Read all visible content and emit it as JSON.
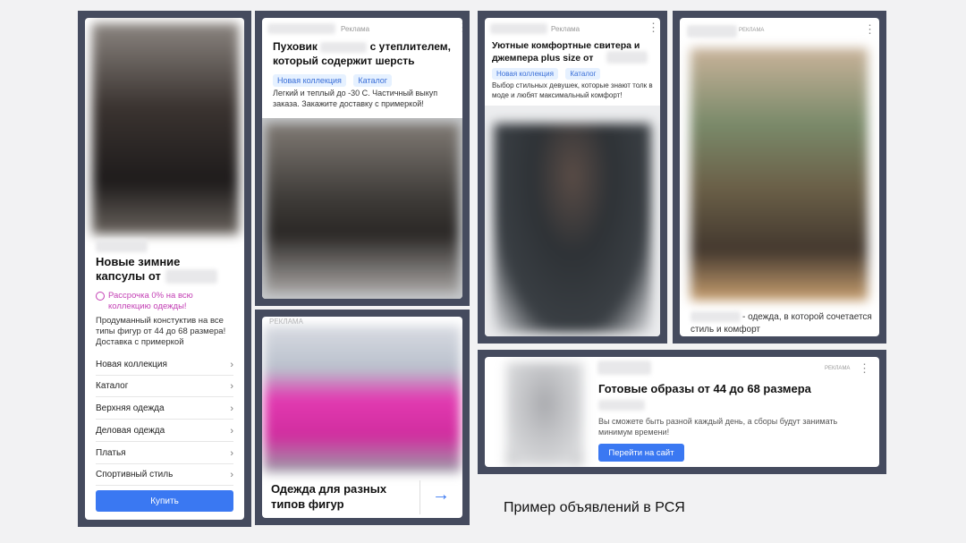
{
  "card1": {
    "title": "Новые зимние капсулы от",
    "installment": "Рассрочка 0% на всю коллекцию одежды!",
    "description": "Продуманный констуктив на все типы фигур от 44 до 68 размера! Доставка с примеркой",
    "menu": [
      "Новая коллекция",
      "Каталог",
      "Верхняя одежда",
      "Деловая одежда",
      "Платья",
      "Спортивный стиль"
    ],
    "buy": "Купить"
  },
  "card2": {
    "ad_label": "Реклама",
    "title_part1": "Пуховик",
    "title_part2": "с утеплителем, который содержит шерсть",
    "chips": [
      "Новая коллекция",
      "Каталог"
    ],
    "description": "Легкий и теплый до -30 С. Частичный выкуп заказа. Закажите доставку с примеркой!"
  },
  "card3": {
    "ad_label": "РЕКЛАМА",
    "title": "Одежда для разных типов фигур",
    "arrow": "→"
  },
  "card4": {
    "ad_label": "Реклама",
    "title": "Уютные комфортные свитера и джемпера plus size от",
    "chips": [
      "Новая коллекция",
      "Каталог"
    ],
    "description": "Выбор стильных девушек, которые знают толк в моде и любят максимальный комфорт!"
  },
  "card5": {
    "ad_label": "РЕКЛАМА",
    "description": "- одежда, в которой сочетается стиль и комфорт"
  },
  "card6": {
    "ad_label": "РЕКЛАМА",
    "title": "Готовые образы от 44 до 68 размера",
    "description": "Вы сможете быть разной каждый день, а сборы будут занимать минимум времени!",
    "button": "Перейти на сайт"
  },
  "caption": "Пример объявлений в РСЯ",
  "colors": {
    "frame": "#454b5e",
    "accent": "#3a78f2",
    "pink": "#c33fb4",
    "chip_bg": "#e6f1ff"
  }
}
